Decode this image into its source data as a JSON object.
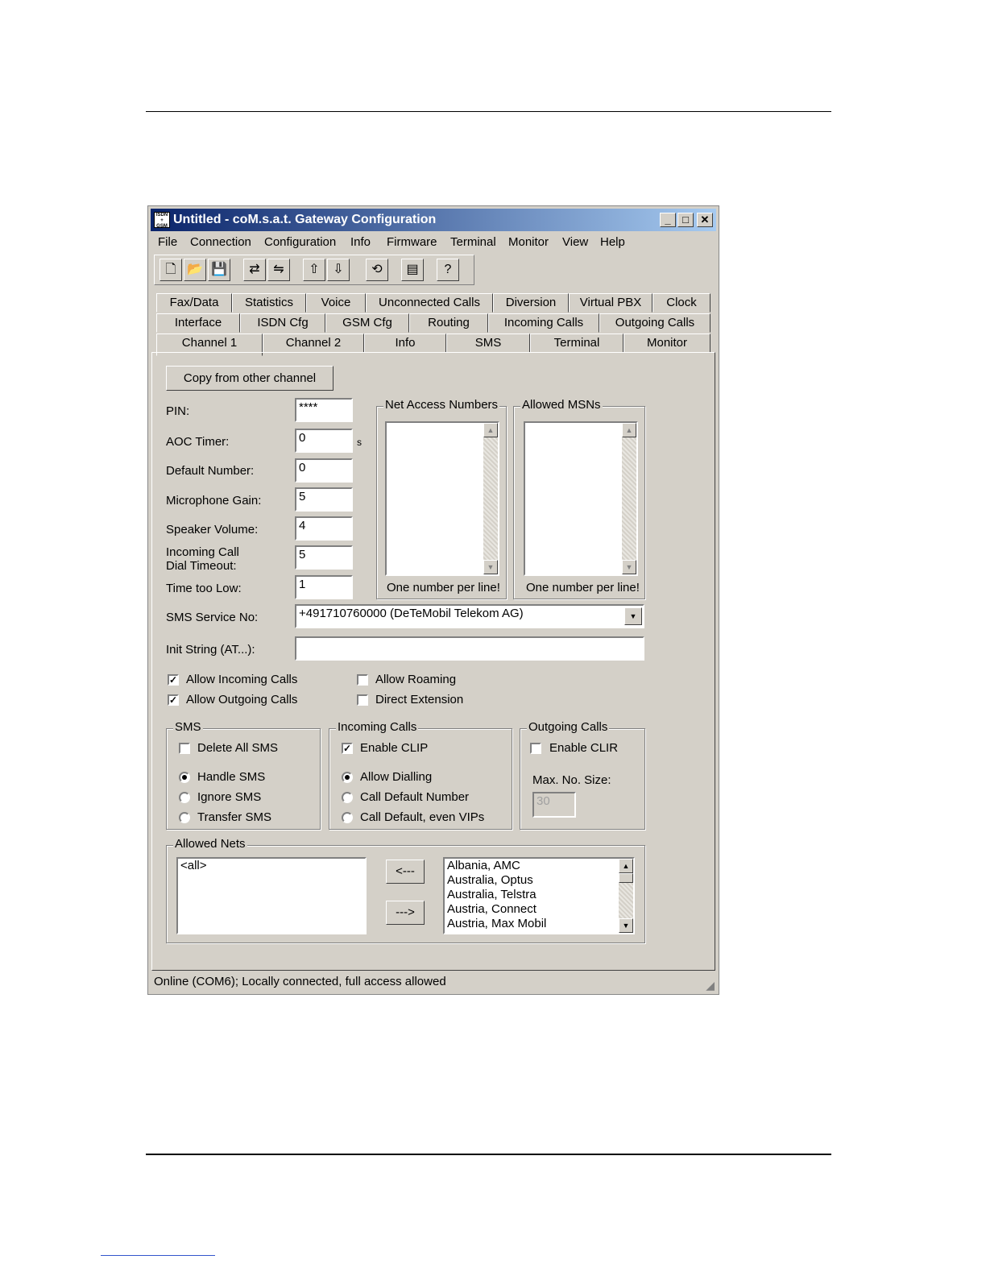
{
  "window": {
    "title": "Untitled - coM.s.a.t. Gateway Configuration",
    "icon_text": "ISDN GSM"
  },
  "menu": [
    "File",
    "Connection",
    "Configuration",
    "Info",
    "Firmware",
    "Terminal",
    "Monitor",
    "View",
    "Help"
  ],
  "toolbar_icons": [
    "new-icon",
    "open-icon",
    "save-icon",
    "connect-icon",
    "disconnect-icon",
    "upload-icon",
    "download-icon",
    "refresh-icon",
    "modem-icon",
    "help-icon"
  ],
  "tabs": {
    "row1": [
      "Fax/Data",
      "Statistics",
      "Voice",
      "Unconnected Calls",
      "Diversion",
      "Virtual PBX",
      "Clock"
    ],
    "row2": [
      "Interface",
      "ISDN Cfg",
      "GSM Cfg",
      "Routing",
      "Incoming Calls",
      "Outgoing Calls"
    ],
    "row3": [
      "Channel 1",
      "Channel 2",
      "Info",
      "SMS",
      "Terminal",
      "Monitor"
    ],
    "active": "Channel 1"
  },
  "copy_button": "Copy from other channel",
  "fields": {
    "pin": {
      "label": "PIN:",
      "value": "****"
    },
    "aoc": {
      "label": "AOC Timer:",
      "value": "0",
      "unit": "s"
    },
    "default_number": {
      "label": "Default Number:",
      "value": "0"
    },
    "mic_gain": {
      "label": "Microphone Gain:",
      "value": "5"
    },
    "speaker": {
      "label": "Speaker Volume:",
      "value": "4"
    },
    "dial_timeout": {
      "label1": "Incoming Call",
      "label2": "Dial Timeout:",
      "value": "5"
    },
    "time_low": {
      "label": "Time too Low:",
      "value": "1"
    },
    "sms_service": {
      "label": "SMS Service No:",
      "value": "+491710760000 (DeTeMobil Telekom AG)"
    },
    "init_string": {
      "label": "Init String (AT...):",
      "value": ""
    }
  },
  "net_access": {
    "title": "Net Access Numbers",
    "hint": "One number per line!"
  },
  "allowed_msns": {
    "title": "Allowed MSNs",
    "hint": "One number per line!"
  },
  "checks": {
    "allow_incoming": {
      "label": "Allow Incoming Calls",
      "checked": true
    },
    "allow_outgoing": {
      "label": "Allow Outgoing Calls",
      "checked": true
    },
    "allow_roaming": {
      "label": "Allow Roaming",
      "checked": false
    },
    "direct_extension": {
      "label": "Direct Extension",
      "checked": false
    }
  },
  "sms_group": {
    "title": "SMS",
    "delete_all": "Delete All SMS",
    "handle": "Handle SMS",
    "ignore": "Ignore SMS",
    "transfer": "Transfer SMS",
    "selected": "Handle SMS"
  },
  "incoming_group": {
    "title": "Incoming Calls",
    "enable_clip": "Enable CLIP",
    "allow_dialling": "Allow Dialling",
    "call_default": "Call Default Number",
    "call_default_vips": "Call Default, even VIPs",
    "selected": "Allow Dialling"
  },
  "outgoing_group": {
    "title": "Outgoing Calls",
    "enable_clir": "Enable CLIR",
    "max_label": "Max. No. Size:",
    "max_value": "30"
  },
  "allowed_nets": {
    "title": "Allowed Nets",
    "selected": [
      "<all>"
    ],
    "add_button": "<---",
    "remove_button": "--->",
    "available": [
      "Albania, AMC",
      "Australia, Optus",
      "Australia, Telstra",
      "Austria, Connect",
      "Austria, Max Mobil"
    ]
  },
  "status": "Online (COM6); Locally connected, full access allowed"
}
